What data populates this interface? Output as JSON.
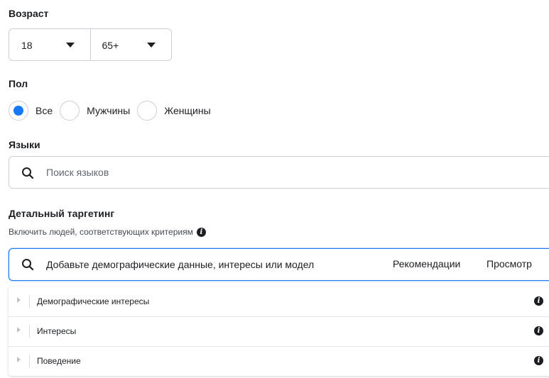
{
  "age": {
    "label": "Возраст",
    "min": "18",
    "max": "65+"
  },
  "gender": {
    "label": "Пол",
    "options": [
      {
        "label": "Все",
        "checked": true
      },
      {
        "label": "Мужчины",
        "checked": false
      },
      {
        "label": "Женщины",
        "checked": false
      }
    ]
  },
  "languages": {
    "label": "Языки",
    "placeholder": "Поиск языков"
  },
  "detailed_targeting": {
    "label": "Детальный таргетинг",
    "sublabel": "Включить людей, соответствующих критериям",
    "placeholder": "Добавьте демографические данные, интересы или модел",
    "recommendations": "Рекомендации",
    "browse": "Просмотр",
    "categories": [
      {
        "label": "Демографические интересы"
      },
      {
        "label": "Интересы"
      },
      {
        "label": "Поведение"
      }
    ]
  },
  "colors": {
    "accent": "#1877f2",
    "border": "#ccd0d5",
    "text": "#1c1e21"
  },
  "icons": {
    "search": "search-icon",
    "info": "info-icon",
    "caret": "caret-down-icon",
    "expand": "expand-triangle-icon"
  }
}
